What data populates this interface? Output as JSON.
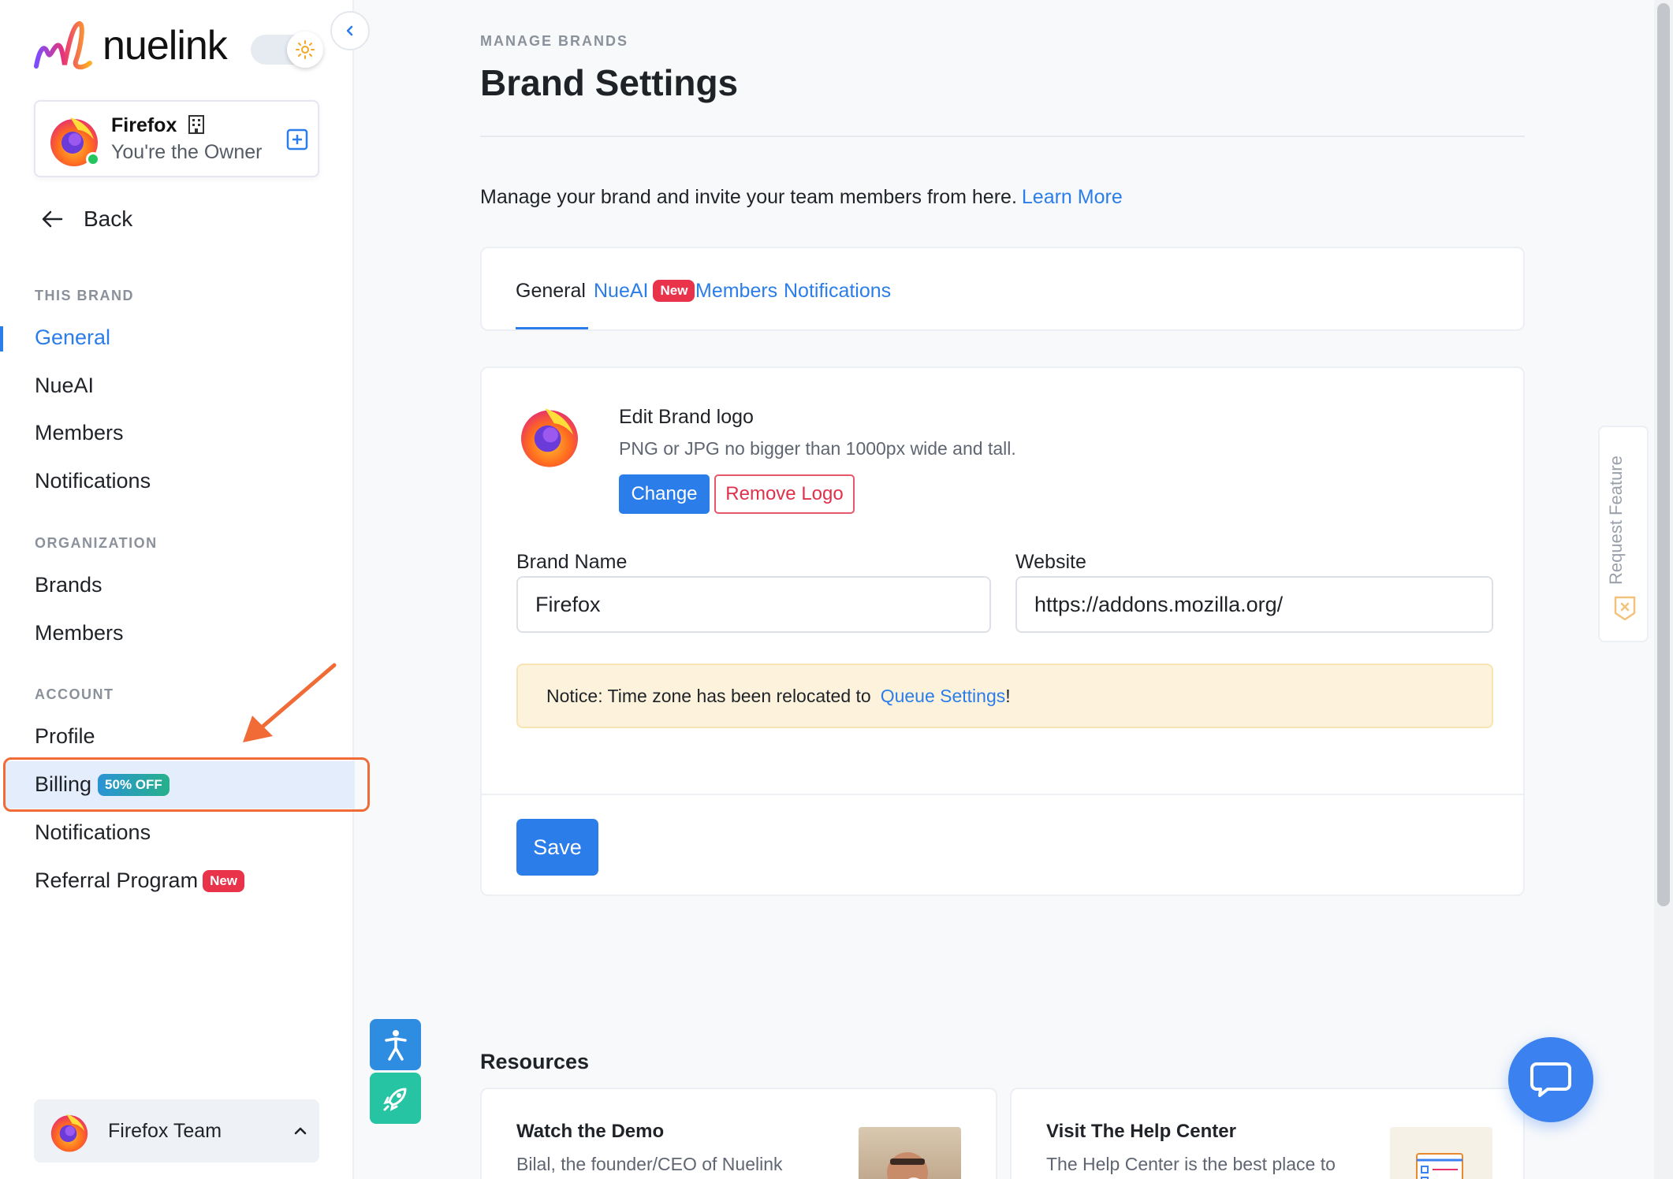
{
  "app": {
    "logo_text": "nuelink",
    "colors": {
      "accent": "#2b7de9",
      "danger": "#e0314b",
      "highlight": "#f06b36",
      "notice_bg": "#fdf3dc"
    }
  },
  "sidebar": {
    "brand": {
      "name": "Firefox",
      "role": "You're the Owner"
    },
    "back_label": "Back",
    "sections": {
      "this_brand": "THIS BRAND",
      "organization": "ORGANIZATION",
      "account": "ACCOUNT"
    },
    "this_brand_items": [
      "General",
      "NueAI",
      "Members",
      "Notifications"
    ],
    "organization_items": [
      "Brands",
      "Members"
    ],
    "account_items": {
      "profile": "Profile",
      "billing": "Billing",
      "billing_badge": "50% OFF",
      "notifications": "Notifications",
      "referral": "Referral Program",
      "referral_badge": "New"
    },
    "active_item": "General",
    "team": {
      "name": "Firefox Team"
    }
  },
  "main": {
    "breadcrumb": "MANAGE BRANDS",
    "title": "Brand Settings",
    "intro": "Manage your brand and invite your team members from here.",
    "learn_more": "Learn More",
    "tabs": [
      {
        "label": "General",
        "active": true
      },
      {
        "label": "NueAI",
        "badge": "New"
      },
      {
        "label": "Members"
      },
      {
        "label": "Notifications"
      }
    ],
    "logo_section": {
      "title": "Edit Brand logo",
      "hint": "PNG or JPG no bigger than 1000px wide and tall.",
      "change_label": "Change",
      "remove_label": "Remove Logo"
    },
    "fields": {
      "brand_name": {
        "label": "Brand Name",
        "value": "Firefox"
      },
      "website": {
        "label": "Website",
        "value": "https://addons.mozilla.org/"
      }
    },
    "notice": {
      "text": "Notice: Time zone has been relocated to",
      "link": "Queue Settings",
      "suffix": "!"
    },
    "save_label": "Save",
    "resources": {
      "title": "Resources",
      "cards": [
        {
          "title": "Watch the Demo",
          "desc": "Bilal, the founder/CEO of Nuelink"
        },
        {
          "title": "Visit The Help Center",
          "desc": "The Help Center is the best place to"
        }
      ]
    }
  },
  "request_feature": "Request Feature"
}
